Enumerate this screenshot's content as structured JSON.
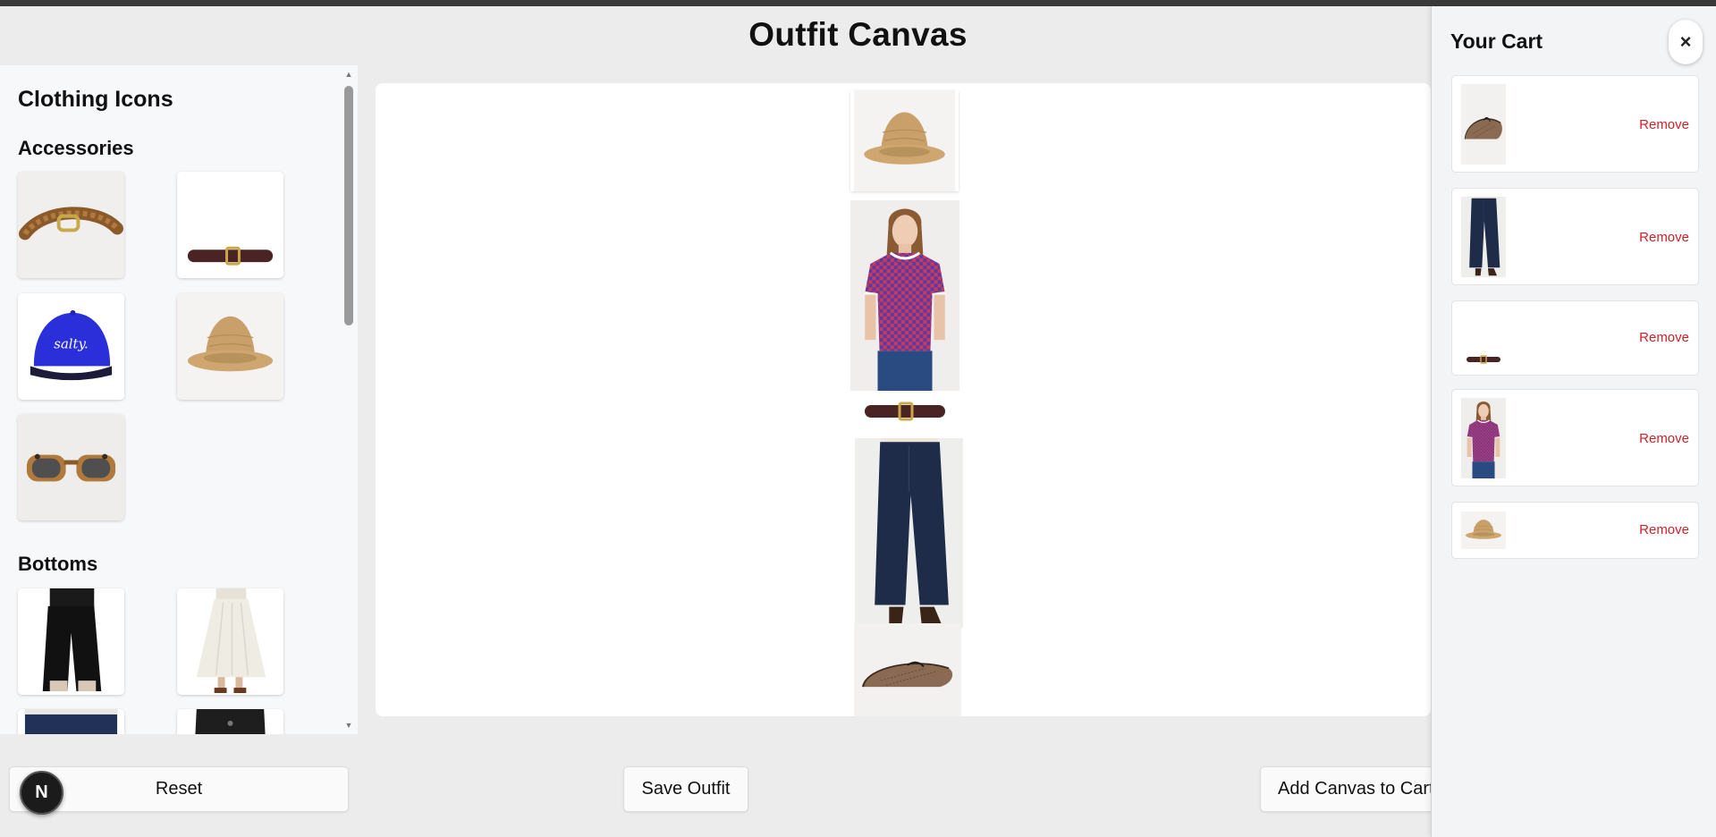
{
  "page": {
    "title": "Outfit Canvas"
  },
  "palette": {
    "title": "Clothing Icons",
    "categories": [
      {
        "name": "Accessories",
        "items": [
          "braided-belt-icon",
          "leather-belt-icon",
          "blue-cap-icon",
          "straw-hat-icon",
          "sunglasses-icon"
        ]
      },
      {
        "name": "Bottoms",
        "items": [
          "black-trousers-icon",
          "white-skirt-icon",
          "jeans-icon",
          "dark-skirt-icon"
        ]
      }
    ],
    "cap_text": "salty."
  },
  "canvas": {
    "pieces": [
      "straw-hat",
      "striped-tshirt",
      "leather-belt",
      "wide-leg-jeans",
      "mesh-flats"
    ]
  },
  "buttons": {
    "reset": "Reset",
    "save": "Save Outfit",
    "add_to_cart": "Add Canvas to Cart",
    "next_badge": "N"
  },
  "cart": {
    "title": "Your Cart",
    "close": "×",
    "items": [
      {
        "icon": "mesh-flats-icon",
        "remove": "Remove"
      },
      {
        "icon": "wide-leg-jeans-icon",
        "remove": "Remove"
      },
      {
        "icon": "leather-belt-icon",
        "remove": "Remove"
      },
      {
        "icon": "striped-tshirt-icon",
        "remove": "Remove"
      },
      {
        "icon": "straw-hat-icon",
        "remove": "Remove"
      }
    ]
  },
  "colors": {
    "remove": "#d0202a",
    "cap_blue": "#2b2fd9",
    "straw": "#c9a06a",
    "denim": "#1e2c4a"
  }
}
